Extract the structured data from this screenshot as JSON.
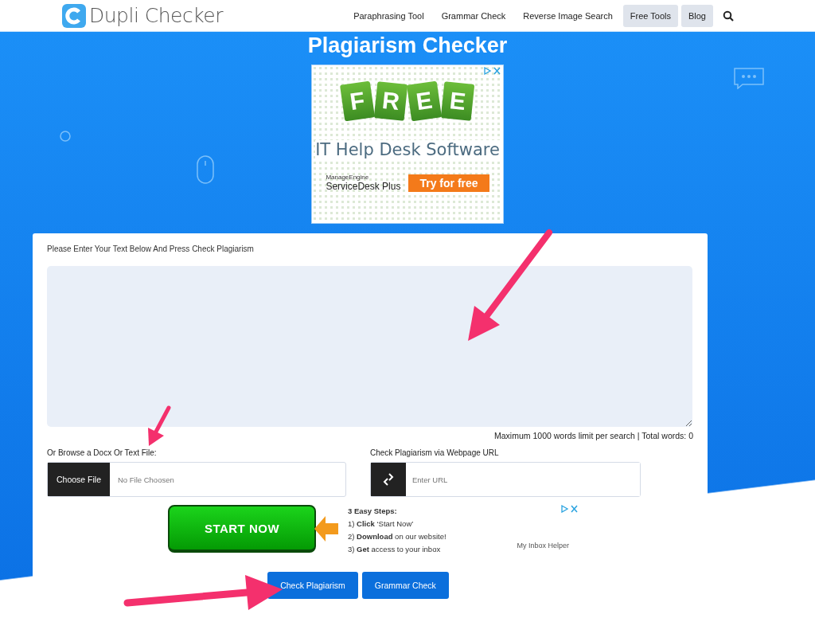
{
  "header": {
    "logo_text": "Dupli Checker",
    "nav": [
      {
        "label": "Paraphrasing Tool",
        "kind": "link"
      },
      {
        "label": "Grammar Check",
        "kind": "link"
      },
      {
        "label": "Reverse Image Search",
        "kind": "link"
      },
      {
        "label": "Free Tools",
        "kind": "pill"
      },
      {
        "label": "Blog",
        "kind": "pill"
      }
    ]
  },
  "title": "Plagiarism Checker",
  "ad_banner": {
    "tags": [
      "F",
      "R",
      "E",
      "E"
    ],
    "headline": "IT Help Desk Software",
    "brand_top": "ManageEngine",
    "brand": "ServiceDesk Plus",
    "cta": "Try for free"
  },
  "card": {
    "prompt": "Please Enter Your Text Below And Press Check Plagiarism",
    "word_info": "Maximum 1000 words limit per search | Total words: 0",
    "file": {
      "label": "Or Browse a Docx Or Text File:",
      "button": "Choose File",
      "status": "No File Choosen"
    },
    "url": {
      "label": "Check Plagiarism via Webpage URL",
      "placeholder": "Enter URL"
    },
    "ad": {
      "button": "START NOW",
      "steps_title": "3 Easy Steps:",
      "steps": [
        "1) **Click** ‘Start Now’",
        "2) **Download** on our website!",
        "3) **Get** access to your inbox"
      ],
      "sponsor": "My Inbox Helper"
    },
    "buttons": [
      "Check Plagiarism",
      "Grammar Check"
    ]
  }
}
